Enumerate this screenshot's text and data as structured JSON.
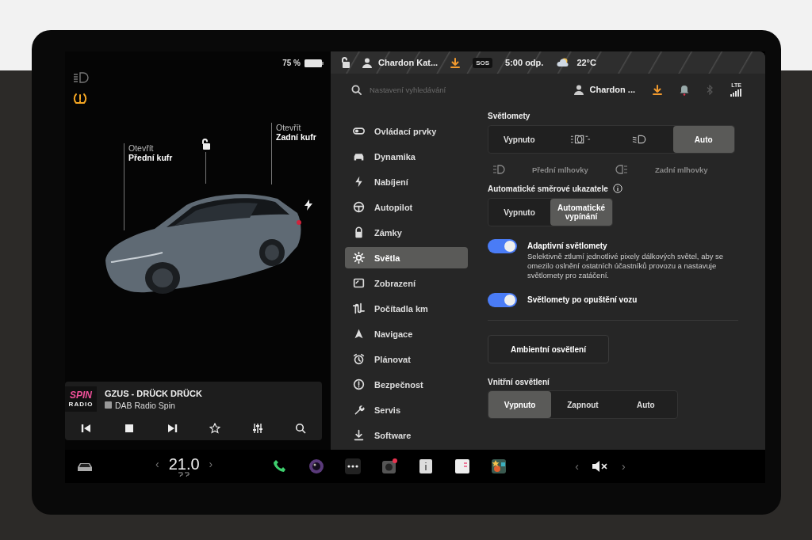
{
  "left_panel": {
    "battery": "75 %",
    "front_trunk": {
      "action": "Otevřít",
      "label": "Přední kufr"
    },
    "rear_trunk": {
      "action": "Otevřít",
      "label": "Zadní kufr"
    }
  },
  "media": {
    "logo_top": "SPIN",
    "logo_bottom": "RADIO",
    "title": "GZUS - DRÜCK DRÜCK",
    "source": "DAB Radio Spin"
  },
  "status_bar": {
    "profile": "Chardon Kat...",
    "sos": "SOS",
    "time": "5:00 odp.",
    "temperature": "22°C"
  },
  "header": {
    "search": {
      "placeholder": "Nastavení vyhledávání"
    },
    "profile": "Chardon ...",
    "signal_label": "LTE"
  },
  "sidebar": {
    "items": [
      {
        "label": "Ovládací prvky",
        "selected": false
      },
      {
        "label": "Dynamika",
        "selected": false
      },
      {
        "label": "Nabíjení",
        "selected": false
      },
      {
        "label": "Autopilot",
        "selected": false
      },
      {
        "label": "Zámky",
        "selected": false
      },
      {
        "label": "Světla",
        "selected": true
      },
      {
        "label": "Zobrazení",
        "selected": false
      },
      {
        "label": "Počítadla km",
        "selected": false
      },
      {
        "label": "Navigace",
        "selected": false
      },
      {
        "label": "Plánovat",
        "selected": false
      },
      {
        "label": "Bezpečnost",
        "selected": false
      },
      {
        "label": "Servis",
        "selected": false
      },
      {
        "label": "Software",
        "selected": false
      }
    ]
  },
  "headlights": {
    "title": "Světlomety",
    "options": [
      {
        "kind": "text",
        "label": "Vypnuto",
        "selected": false
      },
      {
        "kind": "icon",
        "selected": false
      },
      {
        "kind": "icon",
        "selected": false
      },
      {
        "kind": "text",
        "label": "Auto",
        "selected": true
      }
    ]
  },
  "fog_lights": [
    {
      "label": "Přední mlhovky",
      "disabled": true
    },
    {
      "label": "Zadní mlhovky",
      "disabled": true
    }
  ],
  "turn_signals": {
    "title": "Automatické směrové ukazatele",
    "options": [
      {
        "label": "Vypnuto",
        "selected": false
      },
      {
        "label": "Automatické vypínání",
        "selected": true
      }
    ]
  },
  "toggles": [
    {
      "label": "Adaptivní světlomety",
      "description": "Selektivně ztlumí jednotlivé pixely dálkových světel, aby se omezilo oslnění ostatních účastníků provozu a nastavuje světlomety pro zatáčení.",
      "on": true
    },
    {
      "label": "Světlomety po opuštění vozu",
      "on": true
    }
  ],
  "ambient_button": "Ambientní osvětlení",
  "interior_lights": {
    "title": "Vnitřní osvětlení",
    "options": [
      {
        "label": "Vypnuto",
        "selected": true
      },
      {
        "label": "Zapnout",
        "selected": false
      },
      {
        "label": "Auto",
        "selected": false
      }
    ]
  },
  "dock": {
    "temp_down": "‹",
    "temperature": "21.0",
    "temp_up": "›",
    "volume_down": "‹",
    "volume_up": "›"
  }
}
